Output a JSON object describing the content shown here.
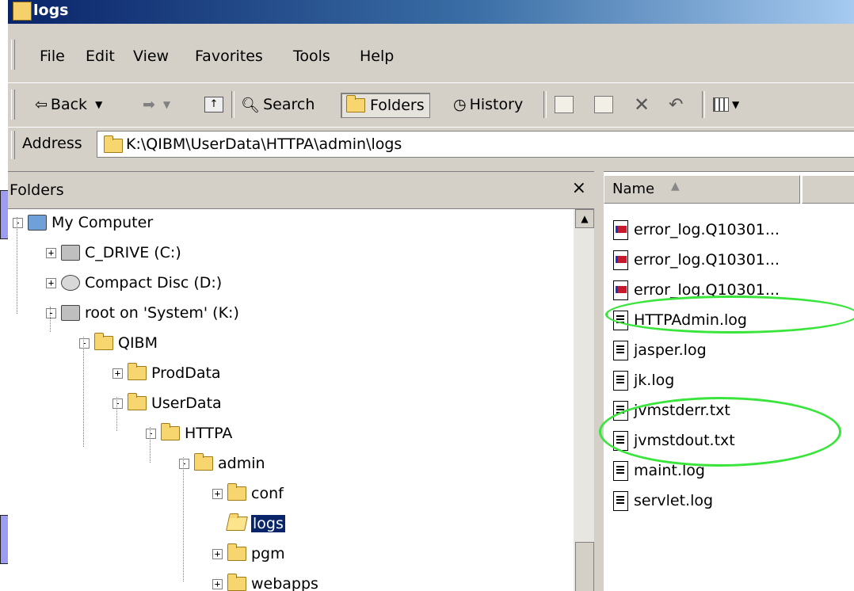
{
  "window": {
    "title": "logs"
  },
  "menu": [
    "File",
    "Edit",
    "View",
    "Favorites",
    "Tools",
    "Help"
  ],
  "toolbar": {
    "back": "Back",
    "search": "Search",
    "folders": "Folders",
    "history": "History"
  },
  "address": {
    "label": "Address",
    "value": "K:\\QIBM\\UserData\\HTTPA\\admin\\logs"
  },
  "folders_pane": {
    "title": "Folders",
    "close": "×",
    "tree": [
      {
        "label": "My Computer",
        "level": 0,
        "expander": "-",
        "icon": "computer-icon"
      },
      {
        "label": "C_DRIVE (C:)",
        "level": 1,
        "expander": "+",
        "icon": "drive-icon"
      },
      {
        "label": "Compact Disc (D:)",
        "level": 1,
        "expander": "+",
        "icon": "cd-icon"
      },
      {
        "label": "root on 'System' (K:)",
        "level": 1,
        "expander": "-",
        "icon": "network-drive-icon"
      },
      {
        "label": "QIBM",
        "level": 2,
        "expander": "-",
        "icon": "folder-icon"
      },
      {
        "label": "ProdData",
        "level": 3,
        "expander": "+",
        "icon": "folder-icon"
      },
      {
        "label": "UserData",
        "level": 3,
        "expander": "-",
        "icon": "folder-icon"
      },
      {
        "label": "HTTPA",
        "level": 4,
        "expander": "-",
        "icon": "folder-icon"
      },
      {
        "label": "admin",
        "level": 5,
        "expander": "-",
        "icon": "folder-icon"
      },
      {
        "label": "conf",
        "level": 6,
        "expander": "+",
        "icon": "folder-icon"
      },
      {
        "label": "logs",
        "level": 6,
        "expander": "",
        "icon": "open-folder-icon",
        "selected": true
      },
      {
        "label": "pgm",
        "level": 6,
        "expander": "+",
        "icon": "folder-icon"
      },
      {
        "label": "webapps",
        "level": 6,
        "expander": "+",
        "icon": "folder-icon"
      }
    ]
  },
  "files_pane": {
    "column_name": "Name",
    "sort_indicator": "▲",
    "files": [
      {
        "name": "error_log.Q10301...",
        "icon": "error-log-icon"
      },
      {
        "name": "error_log.Q10301...",
        "icon": "error-log-icon"
      },
      {
        "name": "error_log.Q10301...",
        "icon": "error-log-icon"
      },
      {
        "name": "HTTPAdmin.log",
        "icon": "text-file-icon"
      },
      {
        "name": "jasper.log",
        "icon": "text-file-icon"
      },
      {
        "name": "jk.log",
        "icon": "text-file-icon"
      },
      {
        "name": "jvmstderr.txt",
        "icon": "text-file-icon"
      },
      {
        "name": "jvmstdout.txt",
        "icon": "text-file-icon"
      },
      {
        "name": "maint.log",
        "icon": "text-file-icon"
      },
      {
        "name": "servlet.log",
        "icon": "text-file-icon"
      }
    ]
  },
  "colors": {
    "titlebar": "#0a246a",
    "chrome": "#d4d0c8",
    "highlight_circle": "#39e43b",
    "callout": "#9c9cf2"
  }
}
